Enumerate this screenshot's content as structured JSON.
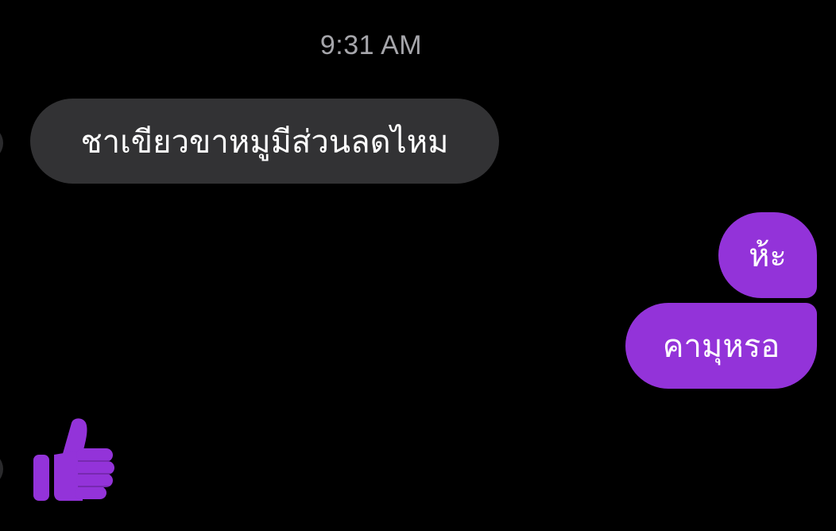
{
  "thread": {
    "timestamp": "9:31 AM",
    "messages": [
      {
        "side": "incoming",
        "text": "ชาเขียวขาหมูมีส่วนลดไหม"
      },
      {
        "side": "outgoing",
        "text": "ห้ะ"
      },
      {
        "side": "outgoing",
        "text": "คามุหรอ"
      },
      {
        "side": "incoming",
        "type": "reaction",
        "icon": "thumbs-up-icon"
      }
    ]
  },
  "colors": {
    "background": "#000000",
    "incoming_bubble": "#323234",
    "outgoing_bubble": "#9333d9",
    "timestamp_text": "#a6a6ab",
    "like_icon": "#9333d9"
  }
}
